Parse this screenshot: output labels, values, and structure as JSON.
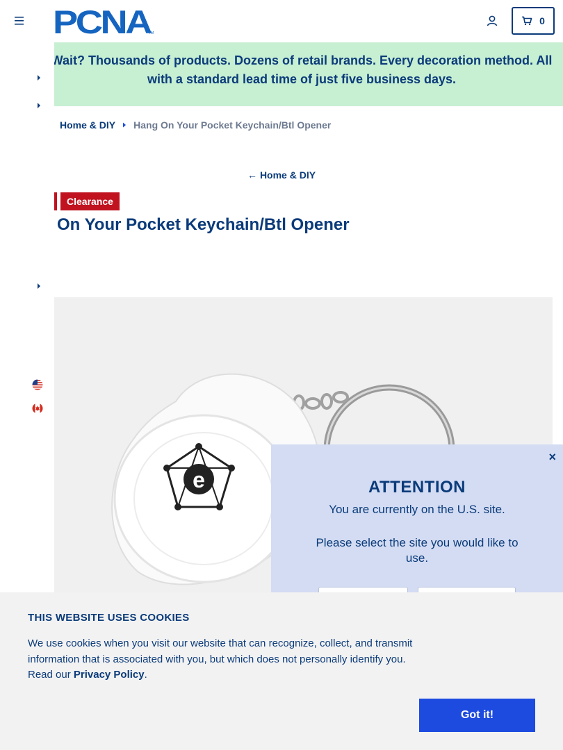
{
  "header": {
    "logo_text": "PCNA",
    "logo_tm": "TM",
    "cart_count": "0"
  },
  "banner": {
    "text": "Wait? Thousands of products. Dozens of retail brands. Every decoration method. All with a standard lead time of just five business days."
  },
  "breadcrumb": {
    "home": "Home & DIY",
    "current": "Hang On Your Pocket Keychain/Btl Opener"
  },
  "back_link": {
    "arrow": "←",
    "label": "Home & DIY"
  },
  "product": {
    "badge": "Clearance",
    "title": "On Your Pocket Keychain/Btl Opener",
    "logo_letter": "e"
  },
  "modal": {
    "close": "×",
    "title": "ATTENTION",
    "line1": "You are currently on the U.S. site.",
    "line2": "Please select the site you would like to use."
  },
  "cookie": {
    "title": "THIS WEBSITE USES COOKIES",
    "text": "We use cookies when you visit our website that can recognize, collect, and transmit information that is associated with you, but which does not personally identify you. Read our ",
    "link": "Privacy Policy",
    "period": ".",
    "button": "Got it!"
  },
  "colors": {
    "brand_navy": "#0b3b7a",
    "banner_green": "#c7efd2",
    "clearance_red": "#c1121f",
    "modal_blue": "#d3dcf3",
    "cookie_button": "#1d4be0"
  },
  "icons": [
    "hamburger-icon",
    "account-icon",
    "cart-icon",
    "caret-right-icon",
    "us-flag-icon",
    "canada-flag-icon",
    "close-icon",
    "arrow-left-icon"
  ]
}
